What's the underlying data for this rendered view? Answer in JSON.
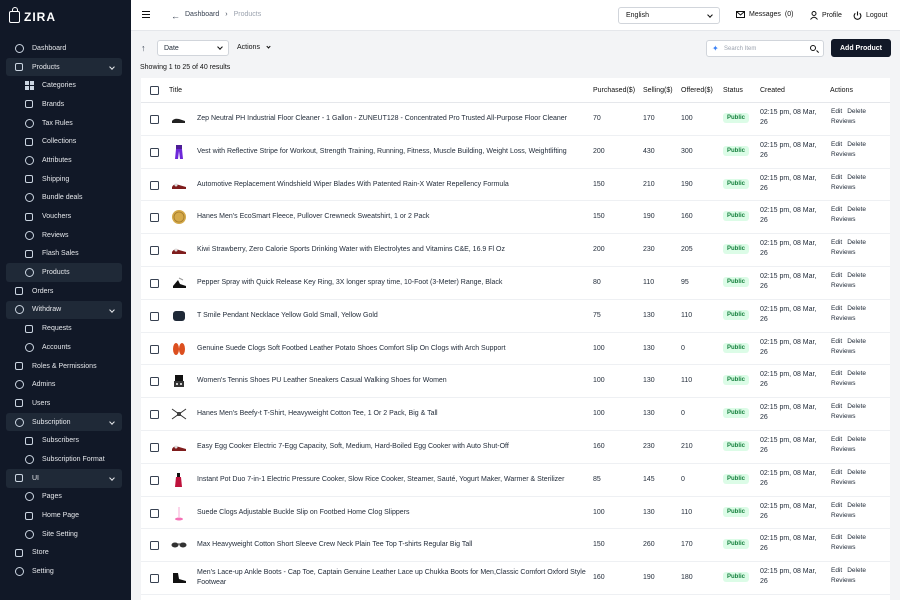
{
  "app": {
    "name": "ZIRA"
  },
  "sidebar": {
    "items": [
      {
        "label": "Dashboard",
        "icon": "home-icon",
        "kind": "top"
      },
      {
        "label": "Products",
        "icon": "bag-icon",
        "kind": "open",
        "chevron": true
      },
      {
        "label": "Categories",
        "icon": "grid-icon",
        "kind": "sub"
      },
      {
        "label": "Brands",
        "icon": "tag-icon",
        "kind": "sub"
      },
      {
        "label": "Tax Rules",
        "icon": "receipt-icon",
        "kind": "sub"
      },
      {
        "label": "Collections",
        "icon": "folder-icon",
        "kind": "sub"
      },
      {
        "label": "Attributes",
        "icon": "sliders-icon",
        "kind": "sub"
      },
      {
        "label": "Shipping",
        "icon": "truck-icon",
        "kind": "sub"
      },
      {
        "label": "Bundle deals",
        "icon": "gift-icon",
        "kind": "sub"
      },
      {
        "label": "Vouchers",
        "icon": "ticket-icon",
        "kind": "sub"
      },
      {
        "label": "Reviews",
        "icon": "star-icon",
        "kind": "sub"
      },
      {
        "label": "Flash Sales",
        "icon": "bolt-icon",
        "kind": "sub"
      },
      {
        "label": "Products",
        "icon": "box-icon",
        "kind": "active"
      },
      {
        "label": "Orders",
        "icon": "cart-icon",
        "kind": "top"
      },
      {
        "label": "Withdraw",
        "icon": "wallet-icon",
        "kind": "open",
        "chevron": true
      },
      {
        "label": "Requests",
        "icon": "inbox-icon",
        "kind": "sub"
      },
      {
        "label": "Accounts",
        "icon": "bank-icon",
        "kind": "sub"
      },
      {
        "label": "Roles & Permissions",
        "icon": "key-icon",
        "kind": "top"
      },
      {
        "label": "Admins",
        "icon": "shield-icon",
        "kind": "top"
      },
      {
        "label": "Users",
        "icon": "user-icon",
        "kind": "top"
      },
      {
        "label": "Subscription",
        "icon": "bell-icon",
        "kind": "open",
        "chevron": true
      },
      {
        "label": "Subscribers",
        "icon": "users-icon",
        "kind": "sub"
      },
      {
        "label": "Subscription Format",
        "icon": "mail-icon",
        "kind": "sub"
      },
      {
        "label": "UI",
        "icon": "layout-icon",
        "kind": "open",
        "chevron": true
      },
      {
        "label": "Pages",
        "icon": "file-icon",
        "kind": "sub"
      },
      {
        "label": "Home Page",
        "icon": "home-icon",
        "kind": "sub"
      },
      {
        "label": "Site Setting",
        "icon": "settings-icon",
        "kind": "sub"
      },
      {
        "label": "Store",
        "icon": "store-icon",
        "kind": "top"
      },
      {
        "label": "Setting",
        "icon": "gear-icon",
        "kind": "top"
      }
    ]
  },
  "topbar": {
    "breadcrumb": [
      "Dashboard",
      "Products"
    ],
    "language": "English",
    "messages_label": "Messages",
    "messages_count": "(0)",
    "profile_label": "Profile",
    "logout_label": "Logout"
  },
  "toolbar": {
    "date_select": "Date",
    "actions_label": "Actions",
    "search_placeholder": "Search Item",
    "add_product": "Add Product"
  },
  "results_text": "Showing 1 to 25 of 40 results",
  "table": {
    "headers": {
      "title": "Title",
      "purchased": "Purchased($)",
      "selling": "Selling($)",
      "offered": "Offered($)",
      "status": "Status",
      "created": "Created",
      "actions": "Actions"
    },
    "rows": [
      {
        "title": "Zep Neutral PH Industrial Floor Cleaner - 1 Gallon - ZUNEUT128 - Concentrated Pro Trusted All-Purpose Floor Cleaner",
        "purchased": "70",
        "selling": "170",
        "offered": "100",
        "status": "Public",
        "created": "02:15 pm, 08 Mar, 26",
        "thumb": "shoe-dark"
      },
      {
        "title": "Vest with Reflective Stripe for Workout, Strength Training, Running, Fitness, Muscle Building, Weight Loss, Weightlifting",
        "purchased": "200",
        "selling": "430",
        "offered": "300",
        "status": "Public",
        "created": "02:15 pm, 08 Mar, 26",
        "thumb": "pants-purple"
      },
      {
        "title": "Automotive Replacement Windshield Wiper Blades With Patented Rain-X Water Repellency Formula",
        "purchased": "150",
        "selling": "210",
        "offered": "190",
        "status": "Public",
        "created": "02:15 pm, 08 Mar, 26",
        "thumb": "shoe-red"
      },
      {
        "title": "Hanes Men's EcoSmart Fleece, Pullover Crewneck Sweatshirt, 1 or 2 Pack",
        "purchased": "150",
        "selling": "190",
        "offered": "160",
        "status": "Public",
        "created": "02:15 pm, 08 Mar, 26",
        "thumb": "coin-gold"
      },
      {
        "title": "Kiwi Strawberry, Zero Calorie Sports Drinking Water with Electrolytes and Vitamins C&E, 16.9 Fl Oz",
        "purchased": "200",
        "selling": "230",
        "offered": "205",
        "status": "Public",
        "created": "02:15 pm, 08 Mar, 26",
        "thumb": "shoe-red"
      },
      {
        "title": "Pepper Spray with Quick Release Key Ring, 3X longer spray time, 10-Foot (3-Meter) Range, Black",
        "purchased": "80",
        "selling": "110",
        "offered": "95",
        "status": "Public",
        "created": "02:15 pm, 08 Mar, 26",
        "thumb": "shoe-mix"
      },
      {
        "title": "T Smile Pendant Necklace Yellow Gold Small, Yellow Gold",
        "purchased": "75",
        "selling": "130",
        "offered": "110",
        "status": "Public",
        "created": "02:15 pm, 08 Mar, 26",
        "thumb": "box-dark"
      },
      {
        "title": "Genuine Suede Clogs Soft Footbed Leather Potato Shoes Comfort Slip On Clogs with Arch Support",
        "purchased": "100",
        "selling": "130",
        "offered": "0",
        "status": "Public",
        "created": "02:15 pm, 08 Mar, 26",
        "thumb": "shoes-orange"
      },
      {
        "title": "Women's Tennis Shoes PU Leather Sneakers Casual Walking Shoes for Women",
        "purchased": "100",
        "selling": "130",
        "offered": "110",
        "status": "Public",
        "created": "02:15 pm, 08 Mar, 26",
        "thumb": "figure-dark"
      },
      {
        "title": "Hanes Men's Beefy-t T-Shirt, Heavyweight Cotton Tee, 1 Or 2 Pack, Big & Tall",
        "purchased": "100",
        "selling": "130",
        "offered": "0",
        "status": "Public",
        "created": "02:15 pm, 08 Mar, 26",
        "thumb": "drone"
      },
      {
        "title": "Easy Egg Cooker Electric 7-Egg Capacity, Soft, Medium, Hard-Boiled Egg Cooker with Auto Shut-Off",
        "purchased": "160",
        "selling": "230",
        "offered": "210",
        "status": "Public",
        "created": "02:15 pm, 08 Mar, 26",
        "thumb": "shoe-red"
      },
      {
        "title": "Instant Pot Duo 7-in-1 Electric Pressure Cooker, Slow Rice Cooker, Steamer, Sauté, Yogurt Maker, Warmer & Sterilizer",
        "purchased": "85",
        "selling": "145",
        "offered": "0",
        "status": "Public",
        "created": "02:15 pm, 08 Mar, 26",
        "thumb": "bottle-red"
      },
      {
        "title": "Suede Clogs Adjustable Buckle Slip on Footbed Home Clog Slippers",
        "purchased": "100",
        "selling": "130",
        "offered": "110",
        "status": "Public",
        "created": "02:15 pm, 08 Mar, 26",
        "thumb": "glass-pink"
      },
      {
        "title": "Max Heavyweight Cotton Short Sleeve Crew Neck Plain Tee Top T-shirts Regular Big Tall",
        "purchased": "150",
        "selling": "260",
        "offered": "170",
        "status": "Public",
        "created": "02:15 pm, 08 Mar, 26",
        "thumb": "glasses"
      },
      {
        "title": "Men's Lace-up Ankle Boots - Cap Toe, Captain Genuine Leather Lace up Chukka Boots for Men,Classic Comfort Oxford Style Footwear",
        "purchased": "160",
        "selling": "190",
        "offered": "180",
        "status": "Public",
        "created": "02:15 pm, 08 Mar, 26",
        "thumb": "shoe-black"
      }
    ],
    "action_labels": {
      "edit": "Edit",
      "delete": "Delete",
      "reviews": "Reviews"
    }
  },
  "colors": {
    "sidebar_bg": "#111827",
    "badge_bg": "#dcfce7",
    "badge_text": "#15803d",
    "accent": "#111827"
  }
}
